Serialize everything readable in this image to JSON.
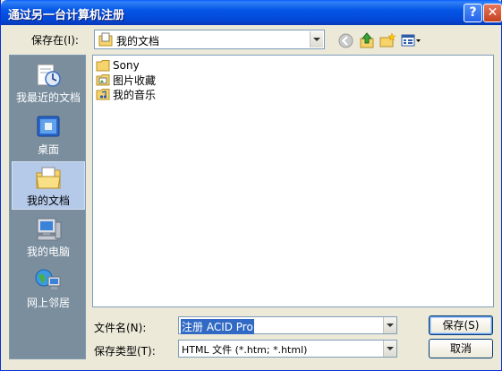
{
  "window": {
    "title": "通过另一台计算机注册"
  },
  "titlebar_buttons": {
    "help": "?",
    "close": "✕"
  },
  "lookin": {
    "label": "保存在(I):",
    "value": "我的文档"
  },
  "toolbar": {
    "icons": [
      "back-icon",
      "up-folder-icon",
      "new-folder-icon",
      "views-menu-icon"
    ]
  },
  "places": [
    {
      "label": "我最近的文档",
      "icon": "recent-documents-icon"
    },
    {
      "label": "桌面",
      "icon": "desktop-icon"
    },
    {
      "label": "我的文档",
      "icon": "my-documents-icon",
      "selected": true
    },
    {
      "label": "我的电脑",
      "icon": "my-computer-icon"
    },
    {
      "label": "网上邻居",
      "icon": "network-places-icon"
    }
  ],
  "files": [
    {
      "name": "Sony",
      "icon": "folder-icon"
    },
    {
      "name": "图片收藏",
      "icon": "pictures-folder-icon"
    },
    {
      "name": "我的音乐",
      "icon": "music-folder-icon"
    }
  ],
  "filename": {
    "label": "文件名(N):",
    "value": "注册 ACID Pro"
  },
  "filetype": {
    "label": "保存类型(T):",
    "value": "HTML 文件 (*.htm; *.html)"
  },
  "buttons": {
    "save": "保存(S)",
    "cancel": "取消"
  },
  "colors": {
    "title_blue": "#0556e6",
    "selection": "#316ac5",
    "places_bg": "#7a8e9e"
  }
}
